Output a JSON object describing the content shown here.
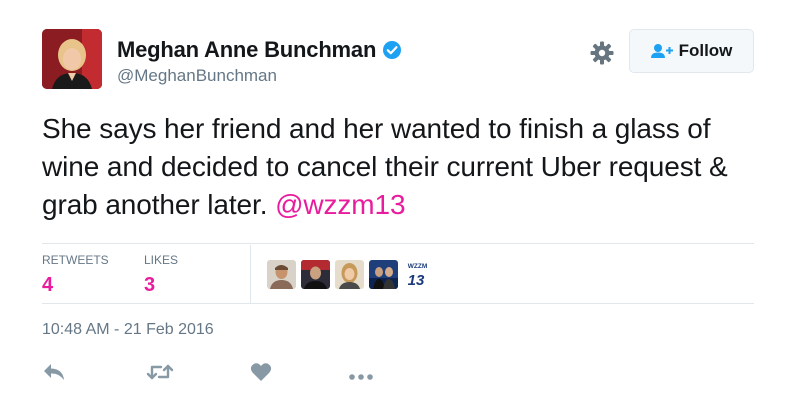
{
  "author": {
    "name": "Meghan Anne Bunchman",
    "handle": "@MeghanBunchman",
    "verified": true
  },
  "follow_button": {
    "label": "Follow"
  },
  "tweet": {
    "text": "She says her friend and her wanted to finish a glass of wine and decided to cancel their current Uber request & grab another later.",
    "mention": "@wzzm13"
  },
  "stats": {
    "retweets_label": "RETWEETS",
    "retweets_count": "4",
    "likes_label": "LIKES",
    "likes_count": "3"
  },
  "likers": [
    {
      "name": "liker-1",
      "color": "#8a6a58"
    },
    {
      "name": "liker-2",
      "color": "#3a3a4a"
    },
    {
      "name": "liker-3",
      "color": "#c79a5a"
    },
    {
      "name": "liker-4",
      "color": "#2b4a8a"
    },
    {
      "name": "liker-5",
      "logo_text": "WZZM",
      "logo_number": "13",
      "color": "#1a3a7a"
    }
  ],
  "timestamp": "10:48 AM - 21 Feb 2016",
  "colors": {
    "accent": "#e81c9d",
    "verified": "#1da1f2",
    "secondary_text": "#657786",
    "icon_gray": "#8899a6"
  },
  "icons": [
    "verified-badge-icon",
    "gear-icon",
    "add-user-icon",
    "reply-icon",
    "retweet-icon",
    "like-icon",
    "more-icon"
  ]
}
